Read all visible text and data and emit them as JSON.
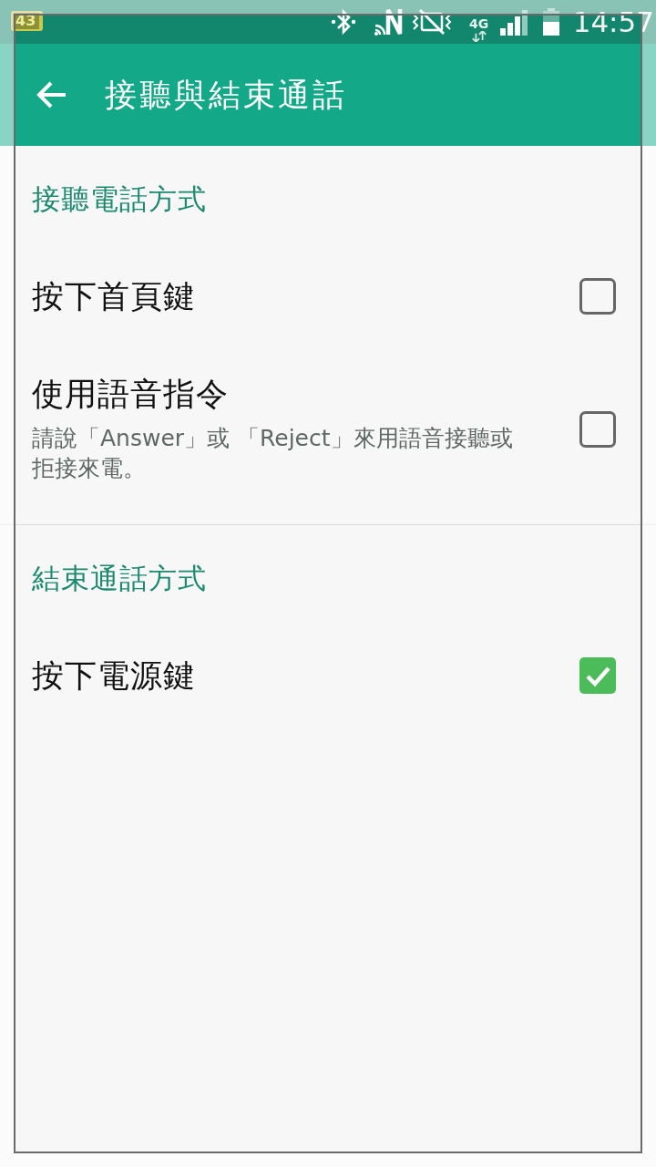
{
  "status_bar": {
    "battery_badge": "43",
    "network_type": "4G",
    "time": "14:57"
  },
  "toolbar": {
    "title": "接聽與結束通話"
  },
  "sections": [
    {
      "header": "接聽電話方式",
      "items": [
        {
          "title": "按下首頁鍵",
          "checked": false
        },
        {
          "title": "使用語音指令",
          "summary": "請說「Answer」或 「Reject」來用語音接聽或拒接來電。",
          "checked": false
        }
      ]
    },
    {
      "header": "結束通話方式",
      "items": [
        {
          "title": "按下電源鍵",
          "checked": true
        }
      ]
    }
  ]
}
